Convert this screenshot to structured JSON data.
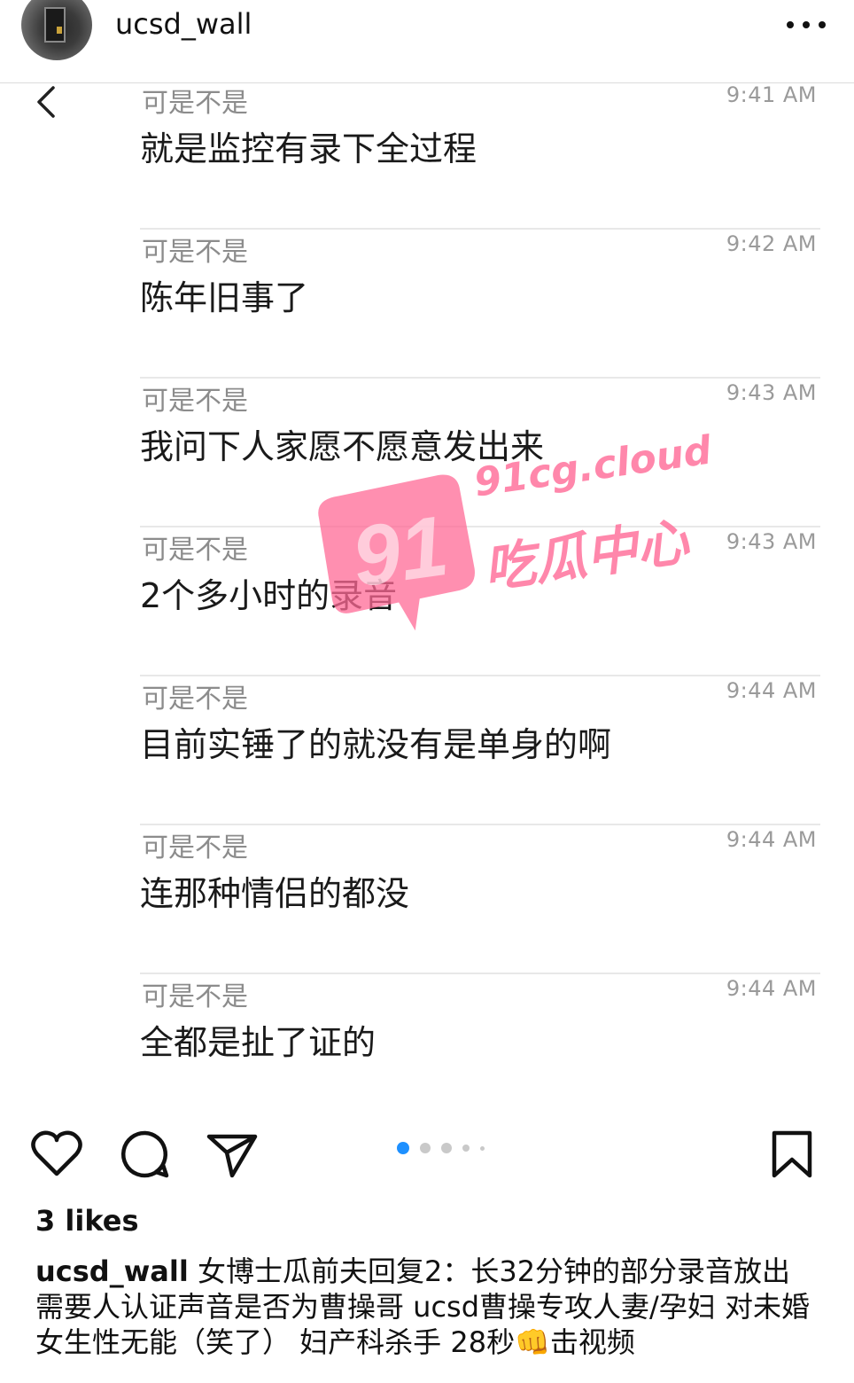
{
  "header": {
    "username": "ucsd_wall"
  },
  "messages": [
    {
      "sender": "可是不是",
      "time": "9:41 AM",
      "text": "就是监控有录下全过程"
    },
    {
      "sender": "可是不是",
      "time": "9:42 AM",
      "text": "陈年旧事了"
    },
    {
      "sender": "可是不是",
      "time": "9:43 AM",
      "text": "我问下人家愿不愿意发出来"
    },
    {
      "sender": "可是不是",
      "time": "9:43 AM",
      "text": "2个多小时的录音"
    },
    {
      "sender": "可是不是",
      "time": "9:44 AM",
      "text": "目前实锤了的就没有是单身的啊"
    },
    {
      "sender": "可是不是",
      "time": "9:44 AM",
      "text": "连那种情侣的都没"
    },
    {
      "sender": "可是不是",
      "time": "9:44 AM",
      "text": "全都是扯了证的"
    }
  ],
  "watermark": {
    "number": "91",
    "site": "91cg.cloud",
    "name": "吃瓜中心",
    "color": "#ff6996"
  },
  "carousel": {
    "total": 5,
    "active_index": 0,
    "active_color": "#1e90ff"
  },
  "likes": "3 likes",
  "caption": {
    "user": "ucsd_wall",
    "text": " 女博士瓜前夫回复2：长32分钟的部分录音放出 需要人认证声音是否为曹操哥 ucsd曹操专攻人妻/孕妇 对未婚女生性无能（笑了） 妇产科杀手 28秒👊击视频"
  }
}
